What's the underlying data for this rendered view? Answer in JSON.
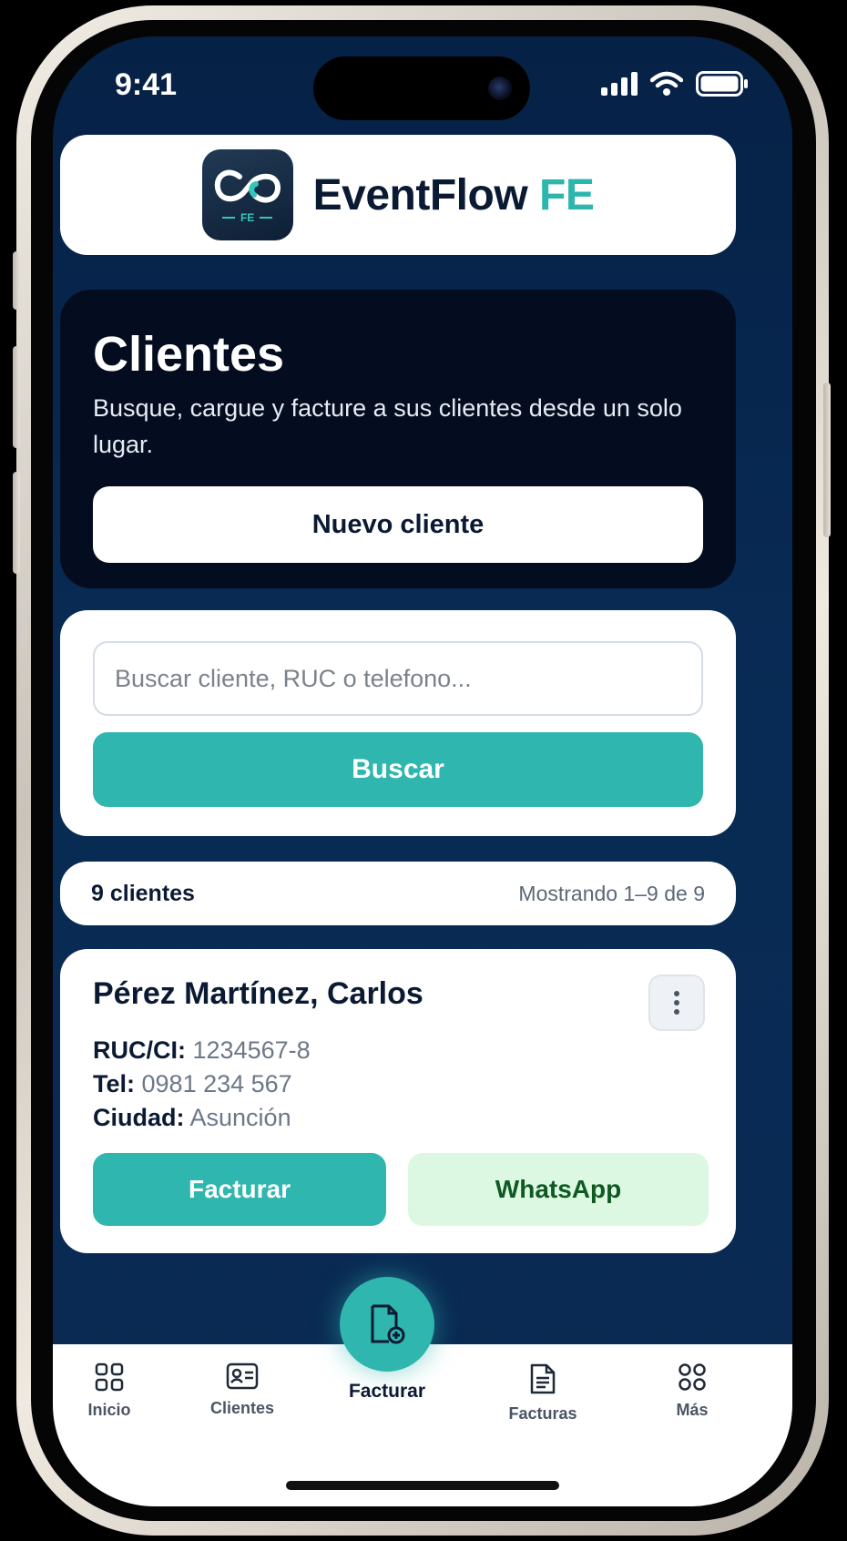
{
  "status_bar": {
    "time": "9:41"
  },
  "header": {
    "brand_main": "EventFlow",
    "brand_accent": "FE",
    "logo_caption": "FE",
    "accent_color": "#2db6ad"
  },
  "hero": {
    "title": "Clientes",
    "subtitle": "Busque, cargue y facture a sus clientes desde un solo lugar.",
    "new_client_label": "Nuevo cliente"
  },
  "search": {
    "placeholder": "Buscar cliente, RUC o telefono...",
    "value": "",
    "button_label": "Buscar"
  },
  "summary": {
    "count_label": "9 clientes",
    "range_label": "Mostrando 1–9 de 9"
  },
  "client": {
    "name": "Pérez Martínez, Carlos",
    "ruc_key": "RUC/CI:",
    "ruc_value": "1234567-8",
    "tel_key": "Tel:",
    "tel_value": "0981 234 567",
    "city_key": "Ciudad:",
    "city_value": "Asunción",
    "invoice_label": "Facturar",
    "whatsapp_label": "WhatsApp"
  },
  "nav": {
    "inicio": "Inicio",
    "clientes": "Clientes",
    "facturar": "Facturar",
    "facturas": "Facturas",
    "mas": "Más"
  }
}
